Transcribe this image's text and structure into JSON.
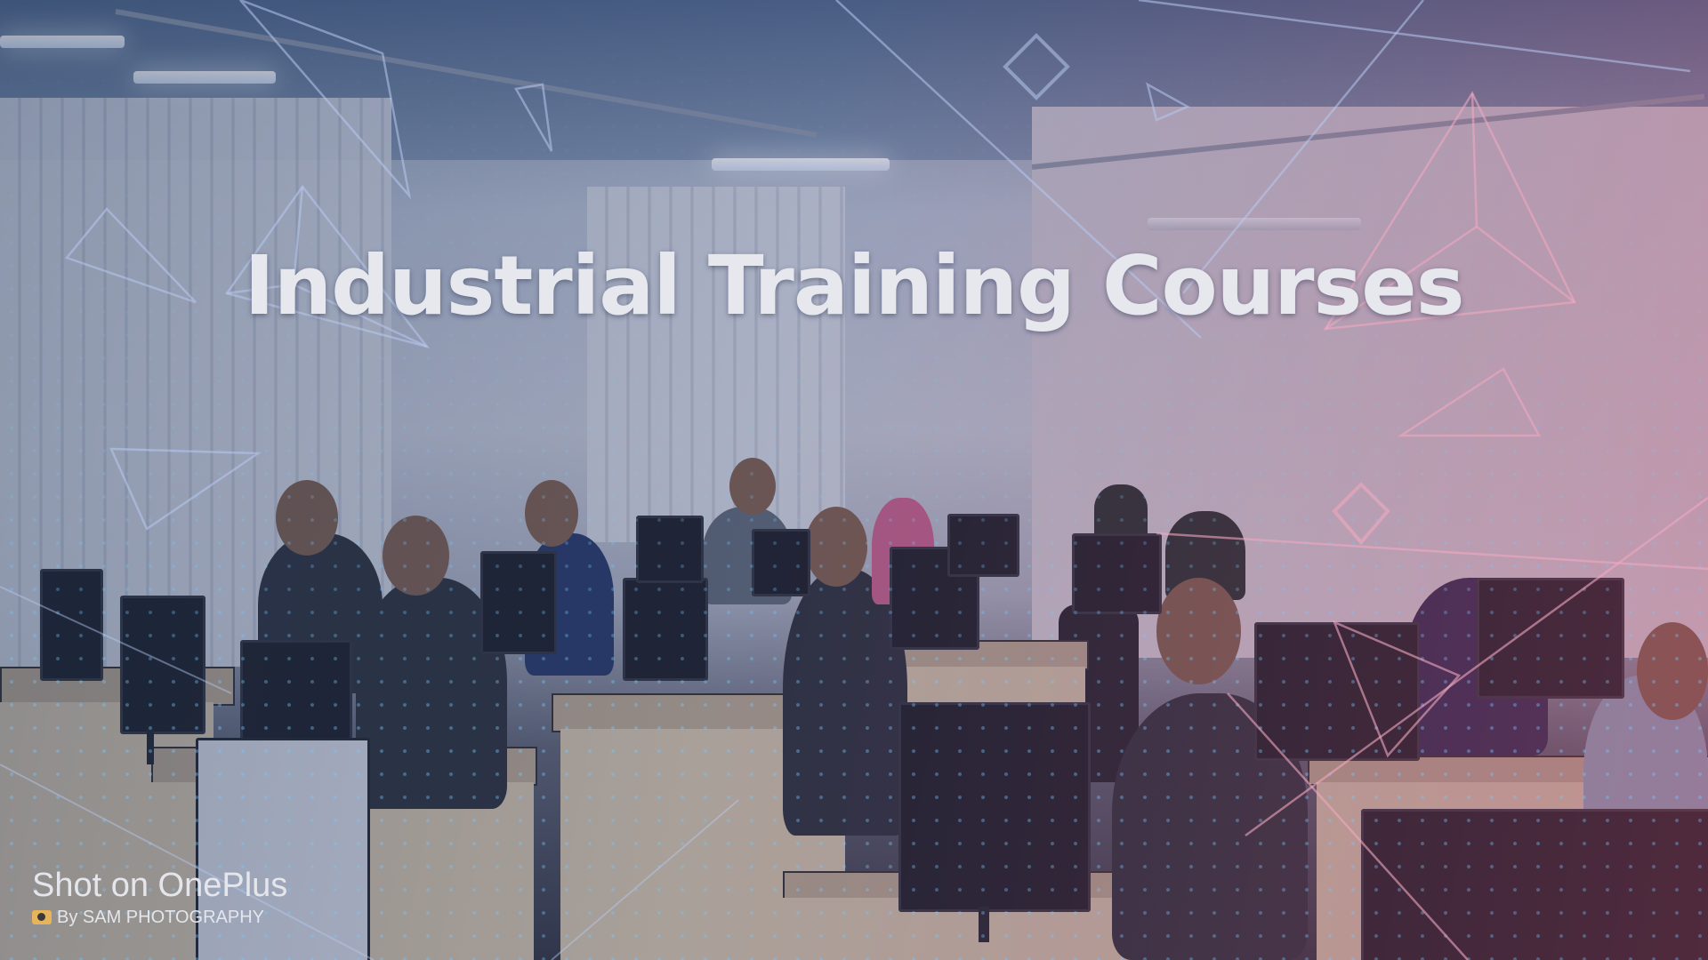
{
  "banner": {
    "title": "Industrial Training Courses",
    "watermark": {
      "line1": "Shot on OnePlus",
      "line2": "By SAM PHOTOGRAPHY",
      "icon": "camera-icon"
    }
  },
  "colors": {
    "title_text": "#e6e8ee",
    "tint_left": "#3c5a8c",
    "tint_right": "#aa466e",
    "dot_pattern": "#78c8ff",
    "shape_outline": "#b8c9f0",
    "shape_outline_pink": "#f0a8c0"
  }
}
